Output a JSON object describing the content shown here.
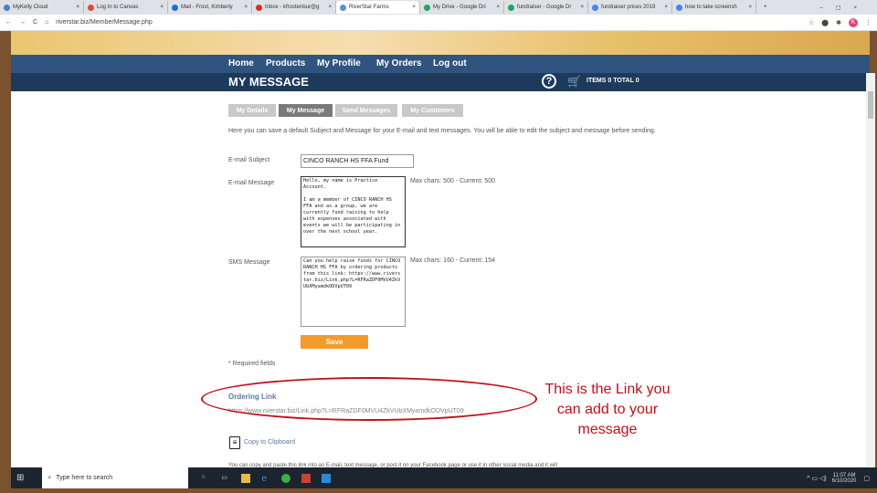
{
  "browser": {
    "tabs": [
      {
        "label": "MyKelly Cloud",
        "icon": "globe-icon",
        "color": "#4a7bd0"
      },
      {
        "label": "Log In to Canvas",
        "icon": "canvas-icon",
        "color": "#e04a3a"
      },
      {
        "label": "Mail - Frost, Kimberly",
        "icon": "outlook-icon",
        "color": "#1f6fc5"
      },
      {
        "label": "Inbox - kfrostenbur@g",
        "icon": "gmail-icon",
        "color": "#d93025"
      },
      {
        "label": "RiverStar Farms",
        "icon": "riverstar-icon",
        "color": "#5b8ed6",
        "active": true
      },
      {
        "label": "My Drive - Google Dri",
        "icon": "drive-icon",
        "color": "#1fa463"
      },
      {
        "label": "fundraiser - Google Dr",
        "icon": "drive-icon",
        "color": "#1fa463"
      },
      {
        "label": "fundraiser prices 2019",
        "icon": "docs-icon",
        "color": "#4285f4"
      },
      {
        "label": "how to take screensh",
        "icon": "google-icon",
        "color": "#4285f4"
      }
    ],
    "url": "riverstar.biz/MemberMessage.php"
  },
  "nav": {
    "items": [
      "Home",
      "Products",
      "My Profile",
      "My Orders",
      "Log out"
    ]
  },
  "header": {
    "title": "MY MESSAGE",
    "items_label": "ITEMS",
    "items_count": "0",
    "total_label": "TOTAL",
    "total_value": "0"
  },
  "tabs": [
    "My Details",
    "My Message",
    "Send Messages",
    "My Customers"
  ],
  "intro": "Here you can save a default Subject and Message for your E-mail and text messages. You will be able to edit the subject and message before sending.",
  "form": {
    "subject_label": "E-mail Subject",
    "subject_value": "CINCO RANCH HS FFA Fund Raising",
    "email_label": "E-mail Message",
    "email_value": "Hello, my name is Practice Account.\n\nI am a member of CINCO RANCH HS FFA and as a group, we are currently fund raising to help with expenses associated with events we will be participating in over the next school year.",
    "email_counter": "Max chars: 500 - Current: 500",
    "sms_label": "SMS Message",
    "sms_value": "Can you help raise funds for CINCO RANCH HS FFA by ordering products from this link: https://www.riverstar.biz/Link.php?L=RFRaZDF0MVU4ZkVUbXMyamdkODVpUT09",
    "sms_counter": "Max chars: 160 - Current: 154",
    "save": "Save",
    "required": "* Required fields"
  },
  "ordering": {
    "title": "Ordering Link",
    "link": "https://www.riverstar.biz/Link.php?L=RFRaZDF0MVU4ZkVUbXMyamdkODVpUT09",
    "copy": "Copy to Clipboard",
    "footer": "You can copy and paste this link into an E-mail, text message, or post it on your Facebook page or use it in other social media and it will"
  },
  "annotation": "This is the Link you can add to your message",
  "taskbar": {
    "search_placeholder": "Type here to search",
    "time": "11:07 AM",
    "date": "6/10/2020"
  },
  "colors": {
    "nav": "#2f5480",
    "title_bar": "#1d3a5c",
    "save": "#f39a2c",
    "annotation": "#c0101a"
  }
}
